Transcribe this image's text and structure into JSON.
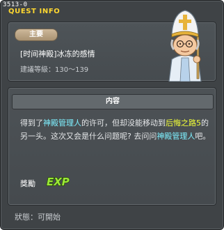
{
  "window": {
    "quest_id": "3513-0",
    "title": "QUEST INFO"
  },
  "quest": {
    "category_tag": "主要",
    "name": "[时间神殿]冰冻的感情",
    "level_range": "建議等級：130～139",
    "npc_portrait": "priest-npc-icon"
  },
  "content": {
    "header": "内容",
    "description": {
      "part1": "得到了",
      "npc1": "神殿管理人",
      "part2": "的许可，但却没能移动到",
      "place": "后悔之路5",
      "part3": "的另一头。这次又会是什么问题呢? 去问问",
      "npc2": "神殿管理人",
      "part4": "吧。"
    },
    "reward_label": "獎勵",
    "reward_icon": "exp-icon",
    "reward_text": "EXP"
  },
  "status": "狀態：可開始",
  "colors": {
    "title": "#ffd830",
    "npc_highlight": "#7ef0ff",
    "place_highlight": "#f2ff38",
    "exp_fill": "#9be836"
  }
}
